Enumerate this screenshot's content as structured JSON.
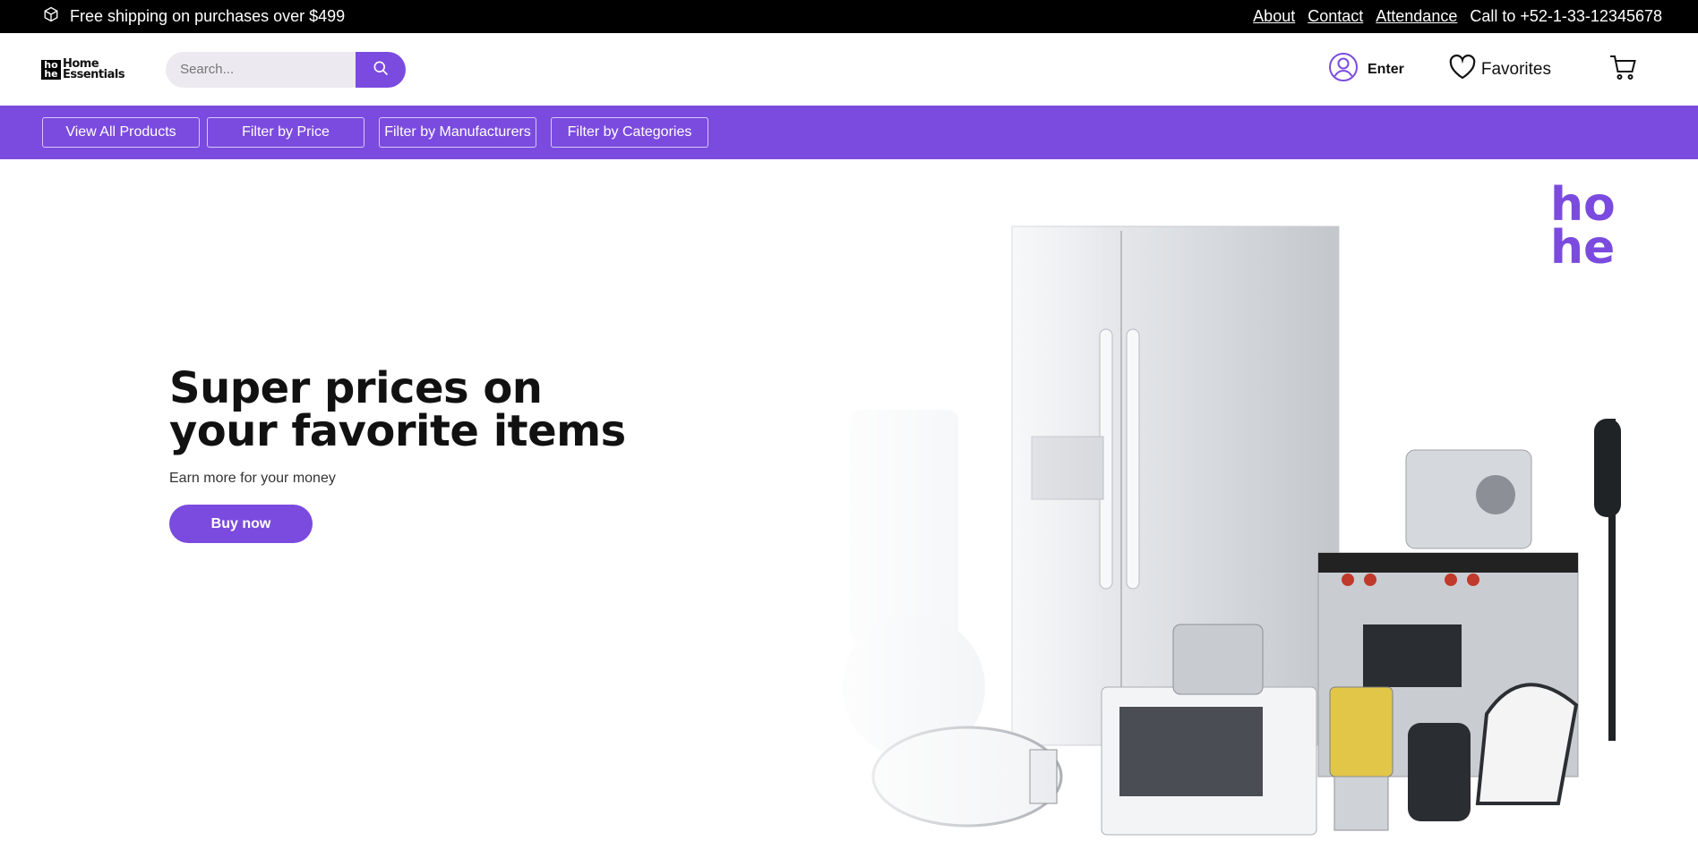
{
  "topbar": {
    "shipping_text": "Free shipping on purchases over $499",
    "links": [
      "About",
      "Contact",
      "Attendance"
    ],
    "phone": "Call to +52-1-33-12345678"
  },
  "header": {
    "logo_mark_top": "ho",
    "logo_mark_bottom": "he",
    "logo_line1": "Home",
    "logo_line2": "Essentials",
    "search_placeholder": "Search...",
    "enter_label": "Enter",
    "favorites_label": "Favorites"
  },
  "nav": {
    "items": [
      "View All Products",
      "Filter by Price",
      "Filter by Manufacturers",
      "Filter by Categories"
    ]
  },
  "hero": {
    "title": "Super prices on your favorite items",
    "subtitle": "Earn more for your money",
    "cta": "Buy now",
    "brand_top": "ho",
    "brand_bottom": "he"
  },
  "colors": {
    "accent": "#7b4bdf",
    "topbar_bg": "#000000"
  },
  "icons": [
    "box-icon",
    "search-icon",
    "user-icon",
    "heart-icon",
    "cart-icon"
  ]
}
